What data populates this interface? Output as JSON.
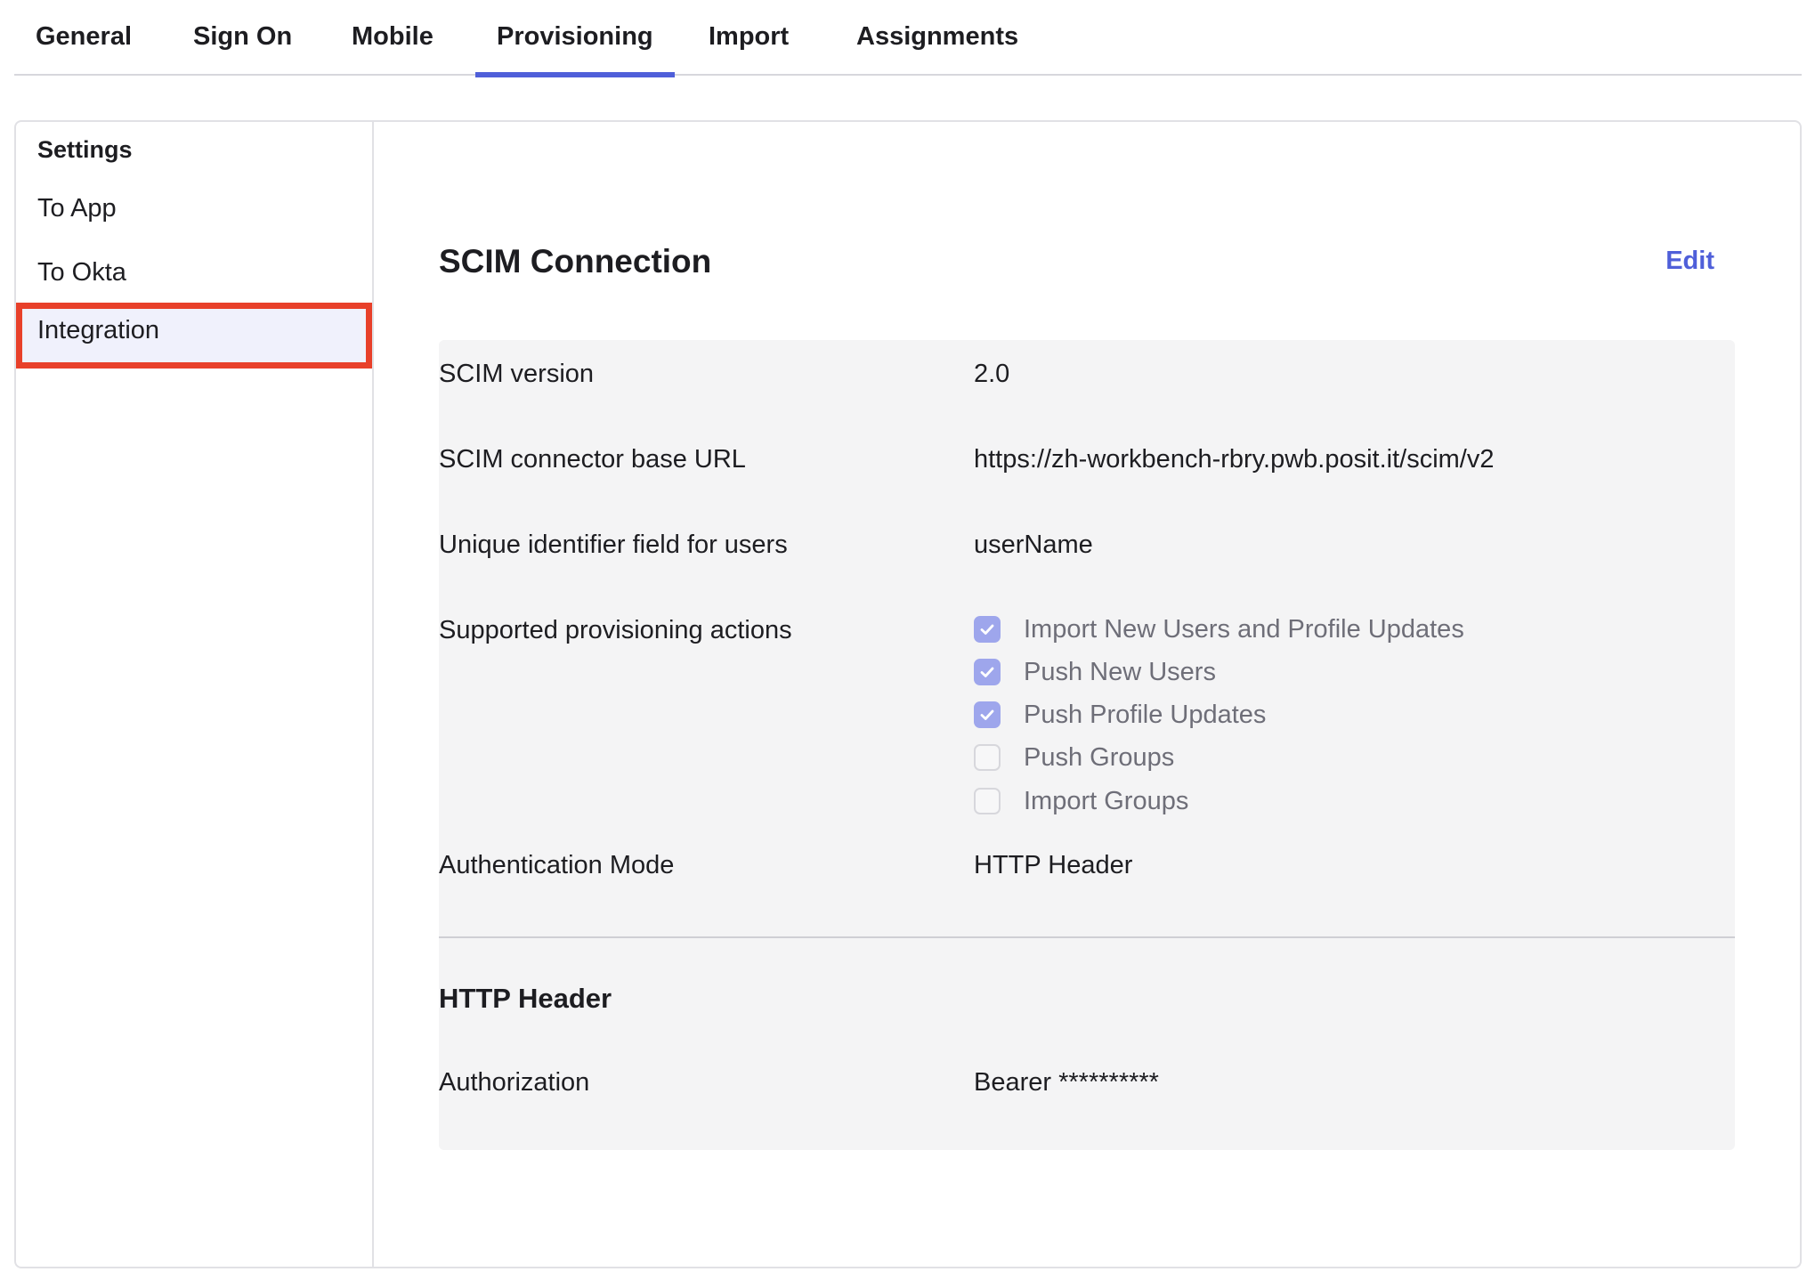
{
  "tabs": [
    {
      "label": "General"
    },
    {
      "label": "Sign On"
    },
    {
      "label": "Mobile"
    },
    {
      "label": "Provisioning",
      "active": true
    },
    {
      "label": "Import"
    },
    {
      "label": "Assignments"
    }
  ],
  "sidebar": {
    "heading": "Settings",
    "items": [
      {
        "label": "To App"
      },
      {
        "label": "To Okta"
      },
      {
        "label": "Integration",
        "selected": true
      }
    ]
  },
  "main": {
    "title": "SCIM Connection",
    "edit_label": "Edit",
    "rows": {
      "scim_version": {
        "label": "SCIM version",
        "value": "2.0"
      },
      "base_url": {
        "label": "SCIM connector base URL",
        "value": "https://zh-workbench-rbry.pwb.posit.it/scim/v2"
      },
      "unique_id": {
        "label": "Unique identifier field for users",
        "value": "userName"
      },
      "actions": {
        "label": "Supported provisioning actions"
      },
      "auth_mode": {
        "label": "Authentication Mode",
        "value": "HTTP Header"
      }
    },
    "actions": [
      {
        "label": "Import New Users and Profile Updates",
        "checked": true
      },
      {
        "label": "Push New Users",
        "checked": true
      },
      {
        "label": "Push Profile Updates",
        "checked": true
      },
      {
        "label": "Push Groups",
        "checked": false
      },
      {
        "label": "Import Groups",
        "checked": false
      }
    ],
    "http_header": {
      "title": "HTTP Header",
      "authorization_label": "Authorization",
      "authorization_value": "Bearer **********"
    }
  },
  "colors": {
    "accent": "#4f5fd9",
    "highlight_border": "#e8402a",
    "checked_fill": "#9ea6ec"
  }
}
